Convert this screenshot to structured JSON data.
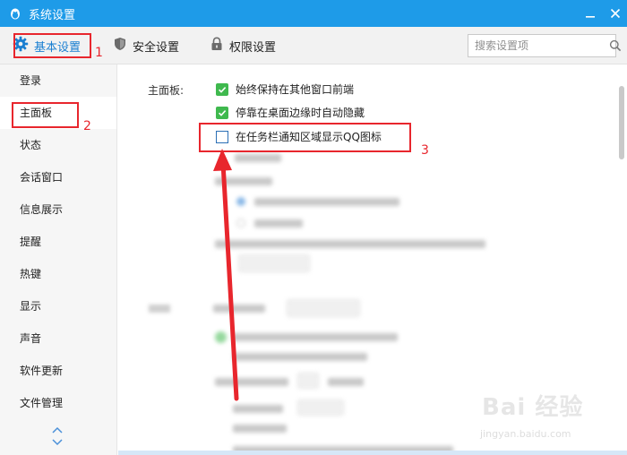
{
  "window": {
    "title": "系统设置",
    "controls": {
      "minimize": "minimize",
      "close": "close"
    }
  },
  "toolbar": {
    "tabs": [
      {
        "label": "基本设置",
        "icon": "gear-icon",
        "active": true
      },
      {
        "label": "安全设置",
        "icon": "shield-icon",
        "active": false
      },
      {
        "label": "权限设置",
        "icon": "lock-icon",
        "active": false
      }
    ],
    "search": {
      "placeholder": "搜索设置项",
      "value": "",
      "icon": "search-icon"
    }
  },
  "sidebar": {
    "items": [
      {
        "label": "登录",
        "active": false
      },
      {
        "label": "主面板",
        "active": true
      },
      {
        "label": "状态",
        "active": false
      },
      {
        "label": "会话窗口",
        "active": false
      },
      {
        "label": "信息展示",
        "active": false
      },
      {
        "label": "提醒",
        "active": false
      },
      {
        "label": "热键",
        "active": false
      },
      {
        "label": "显示",
        "active": false
      },
      {
        "label": "声音",
        "active": false
      },
      {
        "label": "软件更新",
        "active": false
      },
      {
        "label": "文件管理",
        "active": false
      }
    ],
    "scroll_icons": [
      "chevron-up-icon",
      "chevron-down-icon"
    ]
  },
  "content": {
    "main_panel": {
      "label": "主面板:",
      "options": [
        {
          "label": "始终保持在其他窗口前端",
          "checked": true
        },
        {
          "label": "停靠在桌面边缘时自动隐藏",
          "checked": true
        },
        {
          "label": "在任务栏通知区域显示QQ图标",
          "checked": false
        }
      ]
    }
  },
  "annotations": {
    "n1": "1",
    "n2": "2",
    "n3": "3"
  },
  "watermark": {
    "main": "Bai 经验",
    "sub": "jingyan.baidu.com"
  },
  "colors": {
    "titlebar": "#1e9be8",
    "accent_text": "#1a7fd1",
    "checked": "#3fb94e",
    "annotation": "#e8262d"
  }
}
